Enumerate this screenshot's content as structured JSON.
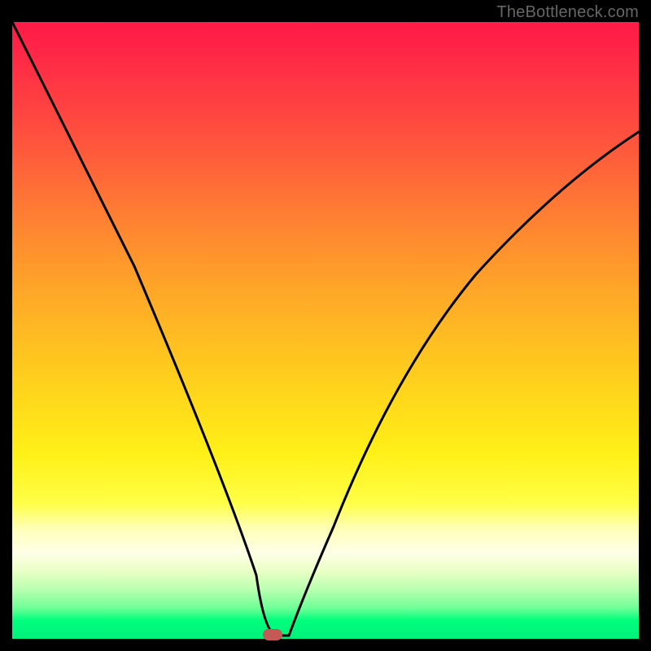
{
  "watermark": "TheBottleneck.com",
  "chart_data": {
    "type": "line",
    "title": "",
    "xlabel": "",
    "ylabel": "",
    "xlim": [
      0,
      100
    ],
    "ylim": [
      0,
      100
    ],
    "series": [
      {
        "name": "bottleneck-curve",
        "x": [
          0,
          4,
          8,
          12,
          16,
          20,
          24,
          28,
          32,
          36,
          38,
          40,
          41,
          42,
          44,
          48,
          52,
          56,
          60,
          64,
          68,
          72,
          76,
          80,
          84,
          88,
          92,
          96,
          100
        ],
        "values": [
          100,
          90,
          80,
          70,
          60,
          51,
          42,
          33,
          24,
          14,
          8,
          2,
          0,
          0,
          4,
          12,
          20,
          27,
          33,
          39,
          44,
          49,
          53,
          57,
          60,
          63,
          66,
          68,
          70
        ]
      }
    ],
    "marker": {
      "x": 41.5,
      "y": 0.5,
      "name": "optimum-marker"
    },
    "gradient_stops": [
      {
        "pos": 0,
        "color": "#ff1a47"
      },
      {
        "pos": 50,
        "color": "#ffb020"
      },
      {
        "pos": 78,
        "color": "#ffff47"
      },
      {
        "pos": 97,
        "color": "#00ff7d"
      },
      {
        "pos": 100,
        "color": "#00f07a"
      }
    ]
  },
  "marker_left_pct": 41.5,
  "marker_top_pct": 99.3
}
